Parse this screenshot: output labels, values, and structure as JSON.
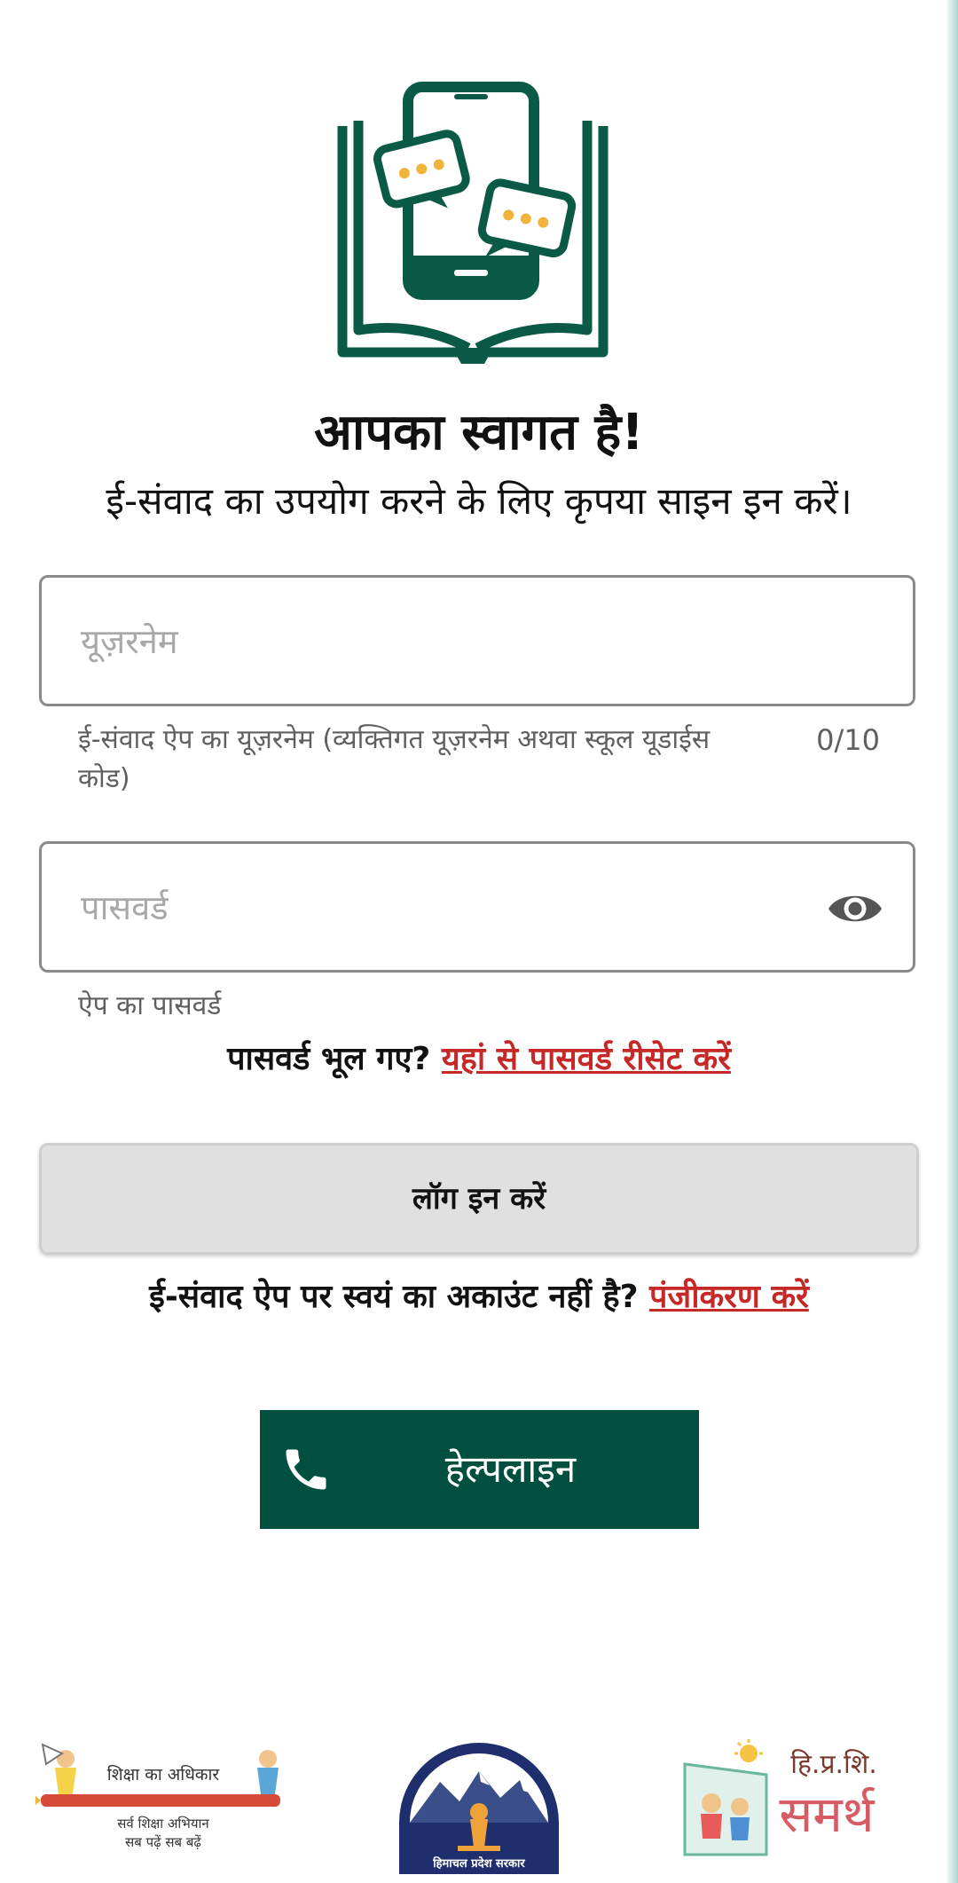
{
  "header": {
    "title": "आपका स्वागत है!",
    "subtitle": "ई-संवाद का उपयोग करने के लिए कृपया साइन इन करें।"
  },
  "username": {
    "placeholder": "यूज़रनेम",
    "value": "",
    "helper": "ई-संवाद ऐप का यूज़रनेम (व्यक्तिगत यूज़रनेम अथवा स्कूल यूडाईस कोड)",
    "counter": "0/10"
  },
  "password": {
    "placeholder": "पासवर्ड",
    "value": "",
    "helper": "ऐप का पासवर्ड",
    "toggle_icon": "eye-icon"
  },
  "forgot": {
    "text": "पासवर्ड भूल गए?",
    "link": "यहां से पासवर्ड रीसेट करें"
  },
  "login_button": "लॉग इन करें",
  "register": {
    "text": "ई-संवाद ऐप पर स्वयं का अकाउंट नहीं है?",
    "link": "पंजीकरण करें"
  },
  "helpline": {
    "label": "हेल्पलाइन",
    "icon": "phone-icon"
  },
  "footer": {
    "rte": {
      "title": "शिक्षा का अधिकार",
      "line1": "सर्व शिक्षा अभियान",
      "line2": "सब पढ़ें सब बढ़ें"
    },
    "seal": {
      "caption": "हिमाचल प्रदेश सरकार"
    },
    "samarth": {
      "top": "हि.प्र.शि.",
      "name": "समर्थ"
    }
  },
  "colors": {
    "brand_green": "#004f3f",
    "link_red": "#c62828",
    "button_gray": "#e0e0e0"
  }
}
